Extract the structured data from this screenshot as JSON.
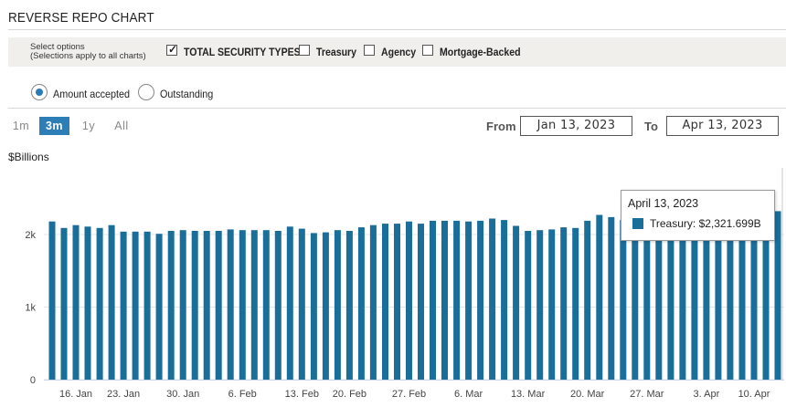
{
  "header": {
    "title": "REVERSE REPO CHART"
  },
  "options": {
    "label_line1": "Select options",
    "label_line2": "(Selections apply to all charts)",
    "checkboxes": [
      {
        "label": "TOTAL SECURITY TYPES",
        "checked": true
      },
      {
        "label": "Treasury",
        "checked": false
      },
      {
        "label": "Agency",
        "checked": false
      },
      {
        "label": "Mortgage-Backed",
        "checked": false
      }
    ]
  },
  "mode": {
    "options": [
      {
        "label": "Amount accepted",
        "selected": true
      },
      {
        "label": "Outstanding",
        "selected": false
      }
    ]
  },
  "range": {
    "buttons": [
      "1m",
      "3m",
      "1y",
      "All"
    ],
    "active": "3m",
    "from_label": "From",
    "from_value": "Jan 13, 2023",
    "to_label": "To",
    "to_value": "Apr 13, 2023"
  },
  "unit_label": "$Billions",
  "tooltip": {
    "date": "April 13, 2023",
    "series": "Treasury:",
    "value": "$2,321.699B",
    "color": "#1a6e9a"
  },
  "chart_data": {
    "type": "bar",
    "ylabel": "$Billions",
    "ylim": [
      0,
      2600
    ],
    "y_ticks": [
      "0",
      "1k",
      "2k"
    ],
    "y_tick_values": [
      0,
      1000,
      2000
    ],
    "x_tick_labels": [
      "16. Jan",
      "23. Jan",
      "30. Jan",
      "6. Feb",
      "13. Feb",
      "20. Feb",
      "27. Feb",
      "6. Mar",
      "13. Mar",
      "20. Mar",
      "27. Mar",
      "3. Apr",
      "10. Apr"
    ],
    "categories": [
      "Jan 13",
      "Jan 17",
      "Jan 18",
      "Jan 19",
      "Jan 20",
      "Jan 23",
      "Jan 24",
      "Jan 25",
      "Jan 26",
      "Jan 27",
      "Jan 30",
      "Jan 31",
      "Feb 1",
      "Feb 2",
      "Feb 3",
      "Feb 6",
      "Feb 7",
      "Feb 8",
      "Feb 9",
      "Feb 10",
      "Feb 13",
      "Feb 14",
      "Feb 15",
      "Feb 16",
      "Feb 17",
      "Feb 21",
      "Feb 22",
      "Feb 23",
      "Feb 24",
      "Feb 27",
      "Feb 28",
      "Mar 1",
      "Mar 2",
      "Mar 3",
      "Mar 6",
      "Mar 7",
      "Mar 8",
      "Mar 9",
      "Mar 10",
      "Mar 13",
      "Mar 14",
      "Mar 15",
      "Mar 16",
      "Mar 17",
      "Mar 20",
      "Mar 21",
      "Mar 22",
      "Mar 23",
      "Mar 24",
      "Mar 27",
      "Mar 28",
      "Mar 29",
      "Mar 30",
      "Mar 31",
      "Apr 3",
      "Apr 4",
      "Apr 5",
      "Apr 6",
      "Apr 10",
      "Apr 11",
      "Apr 12",
      "Apr 13"
    ],
    "series": [
      {
        "name": "Treasury",
        "color": "#1a6e9a",
        "values": [
          2180,
          2090,
          2130,
          2110,
          2090,
          2130,
          2040,
          2040,
          2040,
          2010,
          2050,
          2060,
          2050,
          2050,
          2050,
          2070,
          2060,
          2060,
          2060,
          2050,
          2110,
          2080,
          2020,
          2030,
          2060,
          2050,
          2100,
          2130,
          2150,
          2150,
          2180,
          2150,
          2190,
          2190,
          2190,
          2180,
          2190,
          2220,
          2200,
          2120,
          2050,
          2060,
          2070,
          2100,
          2090,
          2190,
          2270,
          2240,
          2200,
          2220,
          2240,
          2260,
          2260,
          2270,
          2280,
          2300,
          2310,
          2320,
          2320,
          2320,
          2320,
          2322
        ]
      }
    ],
    "grid": true,
    "legend": "tooltip"
  }
}
